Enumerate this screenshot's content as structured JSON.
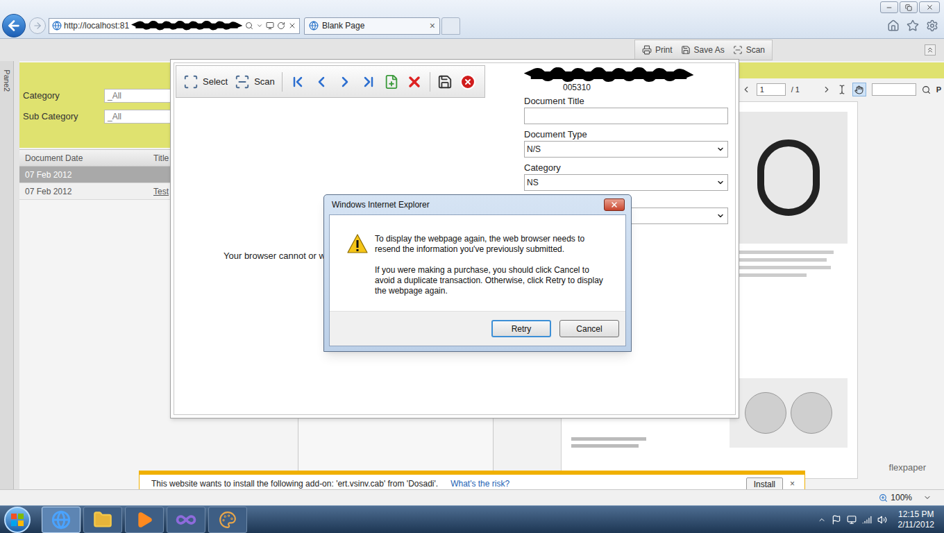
{
  "browser": {
    "address": "http://localhost:81",
    "tab": {
      "label": "Blank Page",
      "close": "×",
      "selected": true
    }
  },
  "page_toolbar": [
    "Print",
    "Save As",
    "Scan"
  ],
  "side_pane": {
    "label": "Pane2"
  },
  "filters": [
    {
      "label": "Category",
      "value": "_All"
    },
    {
      "label": "Sub Category",
      "value": "_All"
    }
  ],
  "table": {
    "columns": [
      "Document Date",
      "Title"
    ],
    "rows": [
      {
        "date": "07 Feb 2012",
        "selected": true
      },
      {
        "date": "07 Feb 2012",
        "title": "Test",
        "selected": false
      }
    ]
  },
  "viewer": {
    "page": "1",
    "page_count": "/ 1",
    "search_label": "P",
    "brand": "flexpaper"
  },
  "modal": {
    "toolbar": [
      "Select",
      "Scan"
    ],
    "message": "Your browser cannot or w",
    "record_id": "005310",
    "fields": [
      {
        "label": "Document Title",
        "kind": "input"
      },
      {
        "label": "Document Type",
        "kind": "select",
        "value": "N/S"
      },
      {
        "label": "Category",
        "kind": "select",
        "value": "NS"
      },
      {
        "kind": "select"
      }
    ]
  },
  "alert": {
    "title": "Windows Internet Explorer",
    "message": [
      "To display the webpage again, the web browser needs to resend the information you've previously submitted.",
      "If you were making a purchase, you should click Cancel to avoid a duplicate transaction. Otherwise, click Retry to display the webpage again."
    ],
    "buttons": [
      {
        "label": "Retry",
        "selected": true
      },
      {
        "label": "Cancel",
        "selected": false
      }
    ]
  },
  "info_bar": {
    "text": "This website wants to install the following add-on: 'ert.vsinv.cab' from 'Dosadi'.",
    "link": "What's the risk?",
    "button": "Install",
    "close": "×"
  },
  "status_bar": {
    "zoom": "100%"
  },
  "taskbar": {
    "apps": [
      {
        "kind": "ie",
        "selected": true
      },
      {
        "kind": "explorer",
        "selected": false
      },
      {
        "kind": "media",
        "selected": false
      },
      {
        "kind": "visual-studio",
        "selected": false
      },
      {
        "kind": "paint",
        "selected": false
      }
    ],
    "time": "12:15 PM",
    "date": "2/11/2012"
  }
}
